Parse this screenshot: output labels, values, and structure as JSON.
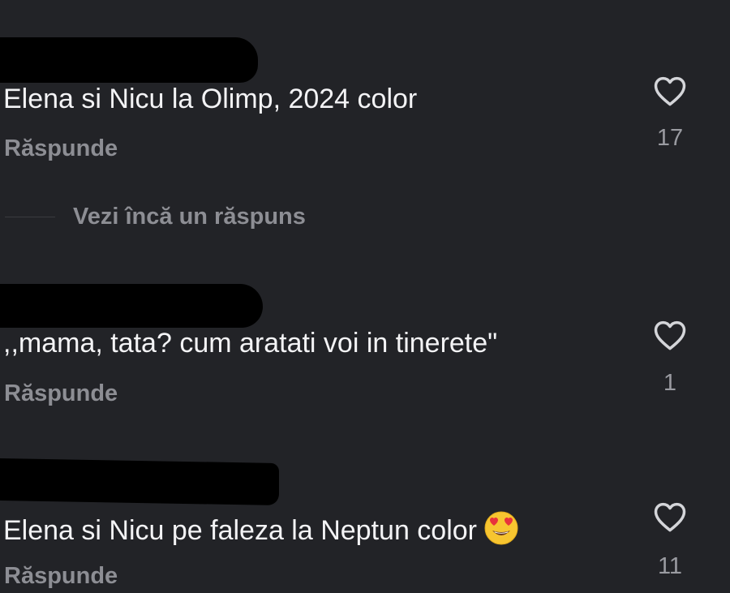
{
  "comments": [
    {
      "text": "Elena si Nicu la Olimp, 2024 color",
      "reply_label": "Răspunde",
      "likes": "17",
      "more_replies": "Vezi încă un răspuns"
    },
    {
      "text": ",,mama, tata? cum aratati voi in tinerete\"",
      "reply_label": "Răspunde",
      "likes": "1"
    },
    {
      "text": "Elena si Nicu pe faleza la Neptun color",
      "emoji": "heart-eyes-emoji",
      "reply_label": "Răspunde",
      "likes": "11"
    }
  ],
  "icons": {
    "like": "heart-outline-icon"
  },
  "colors": {
    "background": "#222327",
    "text": "#f3f3f5",
    "muted": "#8d8e94"
  }
}
